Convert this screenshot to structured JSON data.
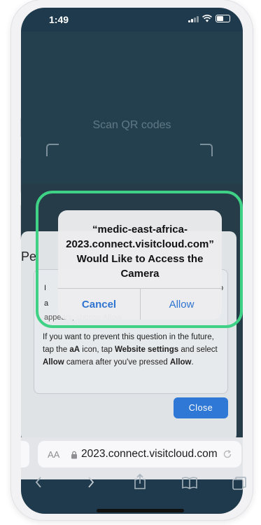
{
  "status_bar": {
    "time": "1:49"
  },
  "scanner": {
    "label": "Scan QR codes"
  },
  "permission_panel": {
    "title_fragment": "Pe",
    "line_a": "I",
    "line_b": "a",
    "line_c": "appears, choose Allow.",
    "line_right": "o",
    "instruction": {
      "t1": "If you want to prevent this question in the future, tap the ",
      "b1": "aA",
      "t2": " icon, tap ",
      "b2": "Website settings",
      "t3": " and select ",
      "b3": "Allow",
      "t4": " camera after you've pressed ",
      "b4": "Allow",
      "t5": "."
    },
    "close_label": "Close"
  },
  "alert": {
    "title": "“medic-east-africa-2023.connect.visitcloud.com” Would Like to Access the Camera",
    "cancel_label": "Cancel",
    "allow_label": "Allow"
  },
  "browser": {
    "text_size_label": "AA",
    "url": "2023.connect.visitcloud.com"
  },
  "colors": {
    "highlight": "#3fd286",
    "accent_blue": "#2f78d6",
    "scan_bg": "#24404f"
  },
  "icons": [
    "signal-icon",
    "wifi-icon",
    "battery-icon",
    "lock-icon",
    "reload-icon",
    "back-icon",
    "forward-icon",
    "share-icon",
    "bookmarks-icon",
    "tabs-icon"
  ]
}
